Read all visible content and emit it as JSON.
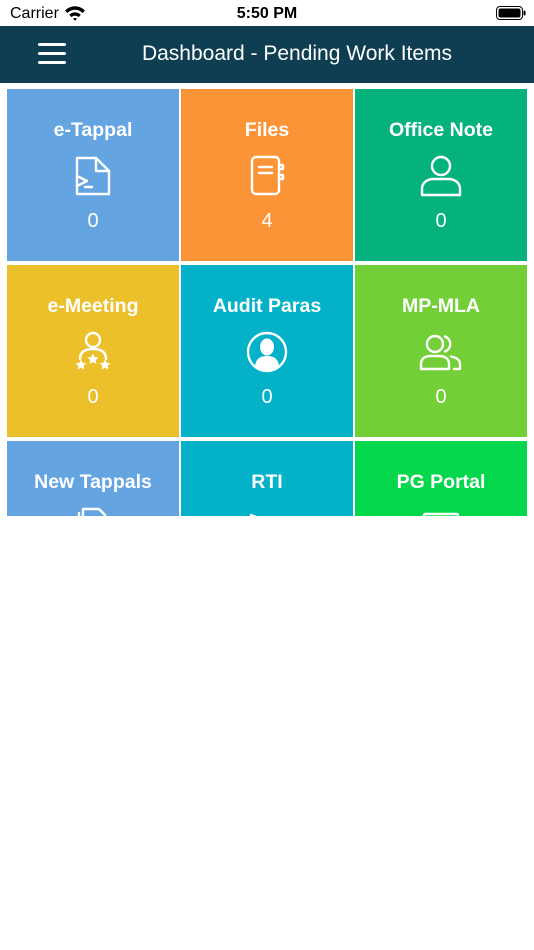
{
  "status_bar": {
    "carrier": "Carrier",
    "time": "5:50 PM"
  },
  "header": {
    "title": "Dashboard - Pending Work Items",
    "menu_icon": "hamburger-menu-icon"
  },
  "tiles": [
    {
      "label": "e-Tappal",
      "count": "0",
      "icon": "document-icon",
      "color": "#63a4e1"
    },
    {
      "label": "Files",
      "count": "4",
      "icon": "file-binder-icon",
      "color": "#fb9337"
    },
    {
      "label": "Office Note",
      "count": "0",
      "icon": "user-icon",
      "color": "#05b27e"
    },
    {
      "label": "e-Meeting",
      "count": "0",
      "icon": "rated-user-icon",
      "color": "#ecc02a"
    },
    {
      "label": "Audit Paras",
      "count": "0",
      "icon": "user-circle-icon",
      "color": "#03b2c8"
    },
    {
      "label": "MP-MLA",
      "count": "0",
      "icon": "users-icon",
      "color": "#72cf37"
    },
    {
      "label": "New Tappals",
      "count": "",
      "icon": "documents-icon",
      "color": "#63a4e1"
    },
    {
      "label": "RTI",
      "count": "",
      "icon": "send-icon",
      "color": "#03b2c8"
    },
    {
      "label": "PG Portal",
      "count": "",
      "icon": "monitor-icon",
      "color": "#05d74c"
    }
  ]
}
